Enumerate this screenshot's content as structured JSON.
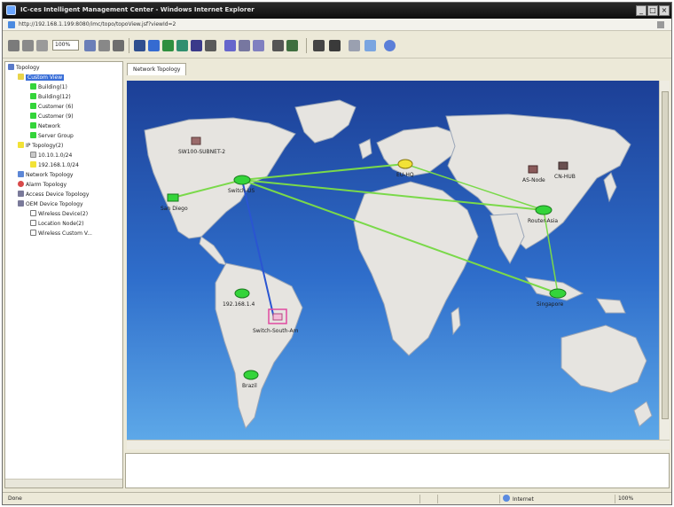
{
  "window": {
    "title": "IC-ces Intelligent Management Center - Windows Internet Explorer",
    "url": "http://192.168.1.199:8080/imc/topo/topoView.jsf?viewId=2"
  },
  "toolbar": {
    "zoom_value": "100%",
    "buttons": [
      "back-icon",
      "forward-icon",
      "zoom-icon",
      "fit-icon",
      "select-icon",
      "pan-icon",
      "refresh-icon",
      "save-icon",
      "layout-icon",
      "grid-icon",
      "link-icon",
      "expand-icon",
      "find-icon",
      "print-icon",
      "export-icon",
      "settings-icon",
      "help-icon",
      "info-icon"
    ]
  },
  "tree": {
    "root_label": "Topology",
    "items": [
      {
        "label": "Custom View",
        "depth": 1,
        "icon": "folder-icon",
        "selected": true
      },
      {
        "label": "Building(1)",
        "depth": 2,
        "icon": "green-node-icon"
      },
      {
        "label": "Building(12)",
        "depth": 2,
        "icon": "green-node-icon"
      },
      {
        "label": "Customer (6)",
        "depth": 2,
        "icon": "green-node-icon"
      },
      {
        "label": "Customer (9)",
        "depth": 2,
        "icon": "green-node-icon"
      },
      {
        "label": "Network",
        "depth": 2,
        "icon": "green-node-icon"
      },
      {
        "label": "Server Group",
        "depth": 2,
        "icon": "green-node-icon"
      },
      {
        "label": "IP Topology(2)",
        "depth": 1,
        "icon": "yellow-node-icon"
      },
      {
        "label": "10.10.1.0/24",
        "depth": 2,
        "icon": "subnet-icon"
      },
      {
        "label": "192.168.1.0/24",
        "depth": 2,
        "icon": "yellow-node-icon"
      },
      {
        "label": "Network Topology",
        "depth": 1,
        "icon": "network-icon"
      },
      {
        "label": "Alarm Topology",
        "depth": 1,
        "icon": "alarm-icon"
      },
      {
        "label": "Access Device Topology",
        "depth": 1,
        "icon": "device-icon"
      },
      {
        "label": "OEM Device Topology",
        "depth": 1,
        "icon": "device-icon"
      },
      {
        "label": "Wireless Device(2)",
        "depth": 2,
        "icon": "wireless-icon"
      },
      {
        "label": "Location Node(2)",
        "depth": 2,
        "icon": "wireless-icon"
      },
      {
        "label": "Wireless Custom V...",
        "depth": 2,
        "icon": "wireless-icon"
      }
    ]
  },
  "tabs": {
    "active_label": "Network Topology"
  },
  "map": {
    "nodes": [
      {
        "id": "a",
        "label": "SW100-SUBNET-2",
        "kind": "device"
      },
      {
        "id": "b",
        "label": "Switch-US",
        "kind": "green"
      },
      {
        "id": "c",
        "label": "San Diego",
        "kind": "green"
      },
      {
        "id": "d",
        "label": "EU-HQ",
        "kind": "yellow"
      },
      {
        "id": "e",
        "label": "AS-Node",
        "kind": "device"
      },
      {
        "id": "f",
        "label": "CN-HUB",
        "kind": "device"
      },
      {
        "id": "g",
        "label": "Router-Asia",
        "kind": "green"
      },
      {
        "id": "h",
        "label": "Singapore",
        "kind": "green"
      },
      {
        "id": "i",
        "label": "192.168.1.4",
        "kind": "green"
      },
      {
        "id": "j",
        "label": "Switch-South-Am",
        "kind": "pink"
      },
      {
        "id": "k",
        "label": "Brazil",
        "kind": "green"
      }
    ]
  },
  "statusbar": {
    "text": "Done",
    "zone_label": "Internet",
    "zoom_label": "100%"
  },
  "colors": {
    "map_ocean_top": "#1c3f96",
    "map_ocean_bottom": "#5da8e8",
    "land": "#e6e4e0",
    "link_green": "#7ad94a",
    "link_blue": "#2a55d1",
    "node_green": "#34d43a",
    "node_yellow": "#f2e236"
  }
}
